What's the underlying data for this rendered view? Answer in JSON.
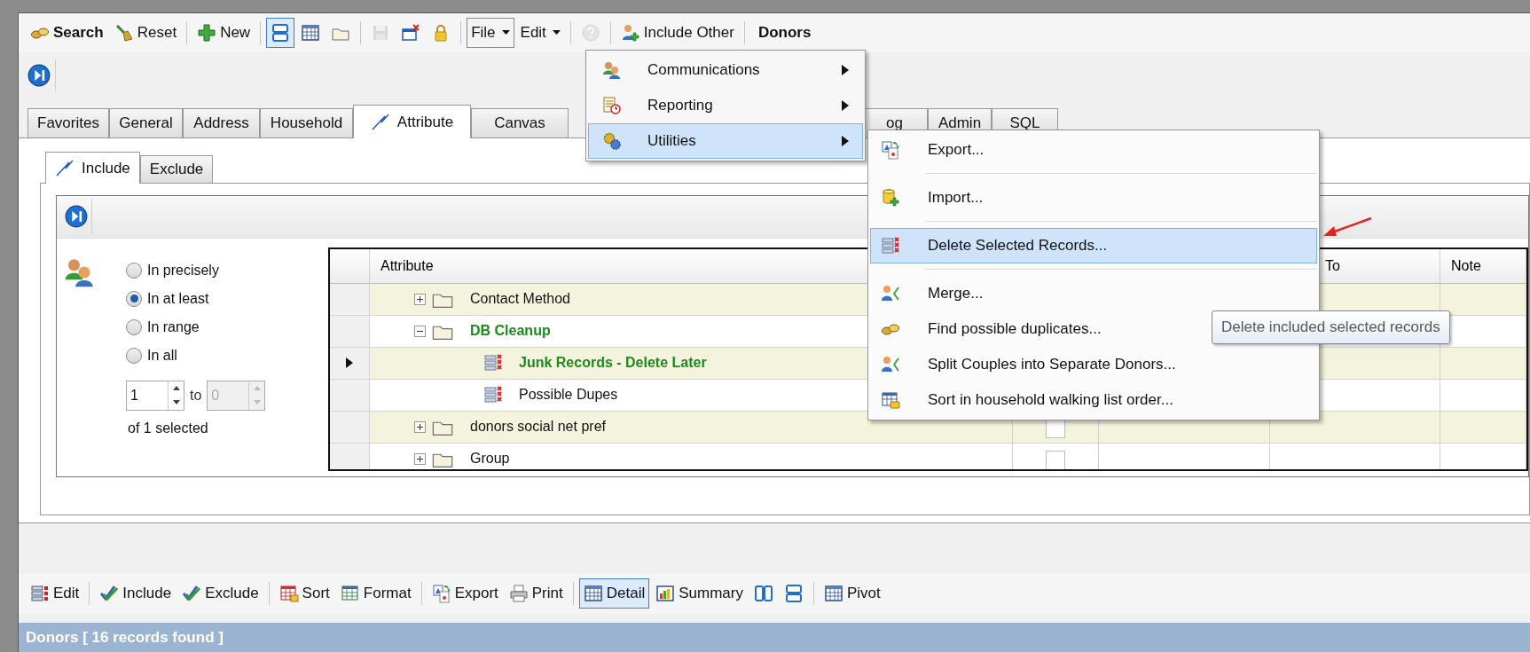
{
  "toolbar": [
    {
      "kind": "strong",
      "label": "Search"
    },
    {
      "kind": "button",
      "label": "Reset"
    },
    {
      "kind": "separator"
    },
    {
      "kind": "button",
      "label": "New"
    },
    {
      "kind": "separator"
    },
    {
      "kind": "toggle",
      "selected": true
    },
    {
      "kind": "icon",
      "disabled": false
    },
    {
      "kind": "icon",
      "disabled": false
    },
    {
      "kind": "separator"
    },
    {
      "kind": "icon",
      "disabled": true
    },
    {
      "kind": "icon",
      "disabled": false
    },
    {
      "kind": "icon",
      "disabled": false
    },
    {
      "kind": "separator"
    },
    {
      "kind": "dropdown",
      "label": "File",
      "selected": true
    },
    {
      "kind": "dropdown",
      "label": "Edit",
      "selected": false
    },
    {
      "kind": "separator"
    },
    {
      "kind": "icon",
      "disabled": true
    },
    {
      "kind": "separator"
    },
    {
      "kind": "button",
      "label": "Include Other"
    },
    {
      "kind": "separator"
    },
    {
      "kind": "title",
      "label": "Donors"
    }
  ],
  "tabs": [
    {
      "label": "Favorites",
      "selected": false
    },
    {
      "label": "General",
      "selected": false
    },
    {
      "label": "Address",
      "selected": false
    },
    {
      "label": "Household",
      "selected": false
    },
    {
      "label": "Attribute",
      "selected": true
    },
    {
      "label": "Canvas",
      "selected": false
    },
    {
      "label": "og",
      "selected": false
    },
    {
      "label": "Admin",
      "selected": false
    },
    {
      "label": "SQL",
      "selected": false
    }
  ],
  "sub_tabs": [
    {
      "label": "Include",
      "selected": true
    },
    {
      "label": "Exclude",
      "selected": false
    }
  ],
  "match_options": [
    {
      "label": "In precisely",
      "selected": false
    },
    {
      "label": "In at least",
      "selected": true
    },
    {
      "label": "In range",
      "selected": false
    },
    {
      "label": "In all",
      "selected": false
    }
  ],
  "range": {
    "from": "1",
    "separator": "to",
    "to": "0",
    "to_disabled": true,
    "summary": "of 1 selected"
  },
  "grid": {
    "columns": [
      "Attribute",
      "To",
      "Note"
    ],
    "rows": [
      {
        "label": "Contact Method",
        "kind": "folder",
        "expanded": false,
        "included": false,
        "current": false
      },
      {
        "label": "DB Cleanup",
        "kind": "folder",
        "expanded": true,
        "included": true,
        "current": false,
        "children": [
          {
            "label": "Junk Records - Delete Later",
            "kind": "record",
            "included": true,
            "current": true
          },
          {
            "label": "Possible Dupes",
            "kind": "record",
            "included": false,
            "current": false
          }
        ]
      },
      {
        "label": "donors social net pref",
        "kind": "folder",
        "expanded": false,
        "included": false,
        "current": false,
        "checked": false
      },
      {
        "label": "Group",
        "kind": "folder",
        "expanded": false,
        "included": false,
        "current": false,
        "checked": false
      }
    ]
  },
  "file_menu": [
    {
      "label": "Communications",
      "submenu": true,
      "selected": false
    },
    {
      "label": "Reporting",
      "submenu": true,
      "selected": false
    },
    {
      "label": "Utilities",
      "submenu": true,
      "selected": true
    }
  ],
  "utilities_menu": [
    {
      "kind": "item",
      "label": "Export...",
      "selected": false
    },
    {
      "kind": "separator"
    },
    {
      "kind": "item",
      "label": "Import...",
      "selected": false
    },
    {
      "kind": "separator"
    },
    {
      "kind": "item",
      "label": "Delete Selected Records...",
      "selected": true
    },
    {
      "kind": "separator"
    },
    {
      "kind": "item",
      "label": "Merge...",
      "selected": false
    },
    {
      "kind": "item",
      "label": "Find possible duplicates...",
      "selected": false
    },
    {
      "kind": "item",
      "label": "Split Couples into Separate Donors...",
      "selected": false
    },
    {
      "kind": "item",
      "label": "Sort in household walking list order...",
      "selected": false
    }
  ],
  "tooltip": "Delete included selected records",
  "bottom_toolbar": [
    {
      "kind": "button",
      "label": "Edit"
    },
    {
      "kind": "separator"
    },
    {
      "kind": "button",
      "label": "Include"
    },
    {
      "kind": "button",
      "label": "Exclude"
    },
    {
      "kind": "separator"
    },
    {
      "kind": "button",
      "label": "Sort"
    },
    {
      "kind": "button",
      "label": "Format"
    },
    {
      "kind": "separator"
    },
    {
      "kind": "button",
      "label": "Export"
    },
    {
      "kind": "button",
      "label": "Print"
    },
    {
      "kind": "separator"
    },
    {
      "kind": "toggle",
      "label": "Detail",
      "selected": true
    },
    {
      "kind": "button",
      "label": "Summary"
    },
    {
      "kind": "icon",
      "disabled": false
    },
    {
      "kind": "icon",
      "disabled": false
    },
    {
      "kind": "separator"
    },
    {
      "kind": "button",
      "label": "Pivot"
    }
  ],
  "status_bar": "Donors [ 16 records found ]"
}
